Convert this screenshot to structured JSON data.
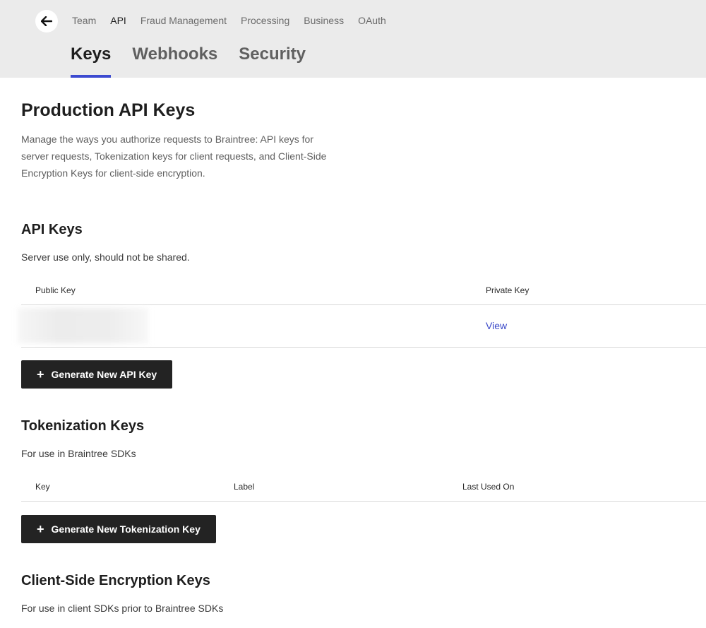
{
  "nav": {
    "items": [
      {
        "label": "Team",
        "active": false
      },
      {
        "label": "API",
        "active": true
      },
      {
        "label": "Fraud Management",
        "active": false
      },
      {
        "label": "Processing",
        "active": false
      },
      {
        "label": "Business",
        "active": false
      },
      {
        "label": "OAuth",
        "active": false
      }
    ]
  },
  "subtabs": [
    {
      "label": "Keys",
      "active": true
    },
    {
      "label": "Webhooks",
      "active": false
    },
    {
      "label": "Security",
      "active": false
    }
  ],
  "page": {
    "title": "Production API Keys",
    "description": "Manage the ways you authorize requests to Braintree: API keys for server requests, Tokenization keys for client requests, and Client-Side Encryption Keys for client-side encryption."
  },
  "api_keys": {
    "title": "API Keys",
    "subtitle": "Server use only, should not be shared.",
    "columns": [
      "Public Key",
      "Private Key"
    ],
    "rows": [
      {
        "public_key": "",
        "private_key_link": "View"
      }
    ],
    "button": "Generate New API Key"
  },
  "tokenization_keys": {
    "title": "Tokenization Keys",
    "subtitle": "For use in Braintree SDKs",
    "columns": [
      "Key",
      "Label",
      "Last Used On"
    ],
    "button": "Generate New Tokenization Key"
  },
  "cse_keys": {
    "title": "Client-Side Encryption Keys",
    "subtitle": "For use in client SDKs prior to Braintree SDKs"
  },
  "colors": {
    "accent": "#3c4ad0",
    "link": "#3a48c8",
    "button_bg": "#232323",
    "header_bg": "#ebebeb"
  }
}
